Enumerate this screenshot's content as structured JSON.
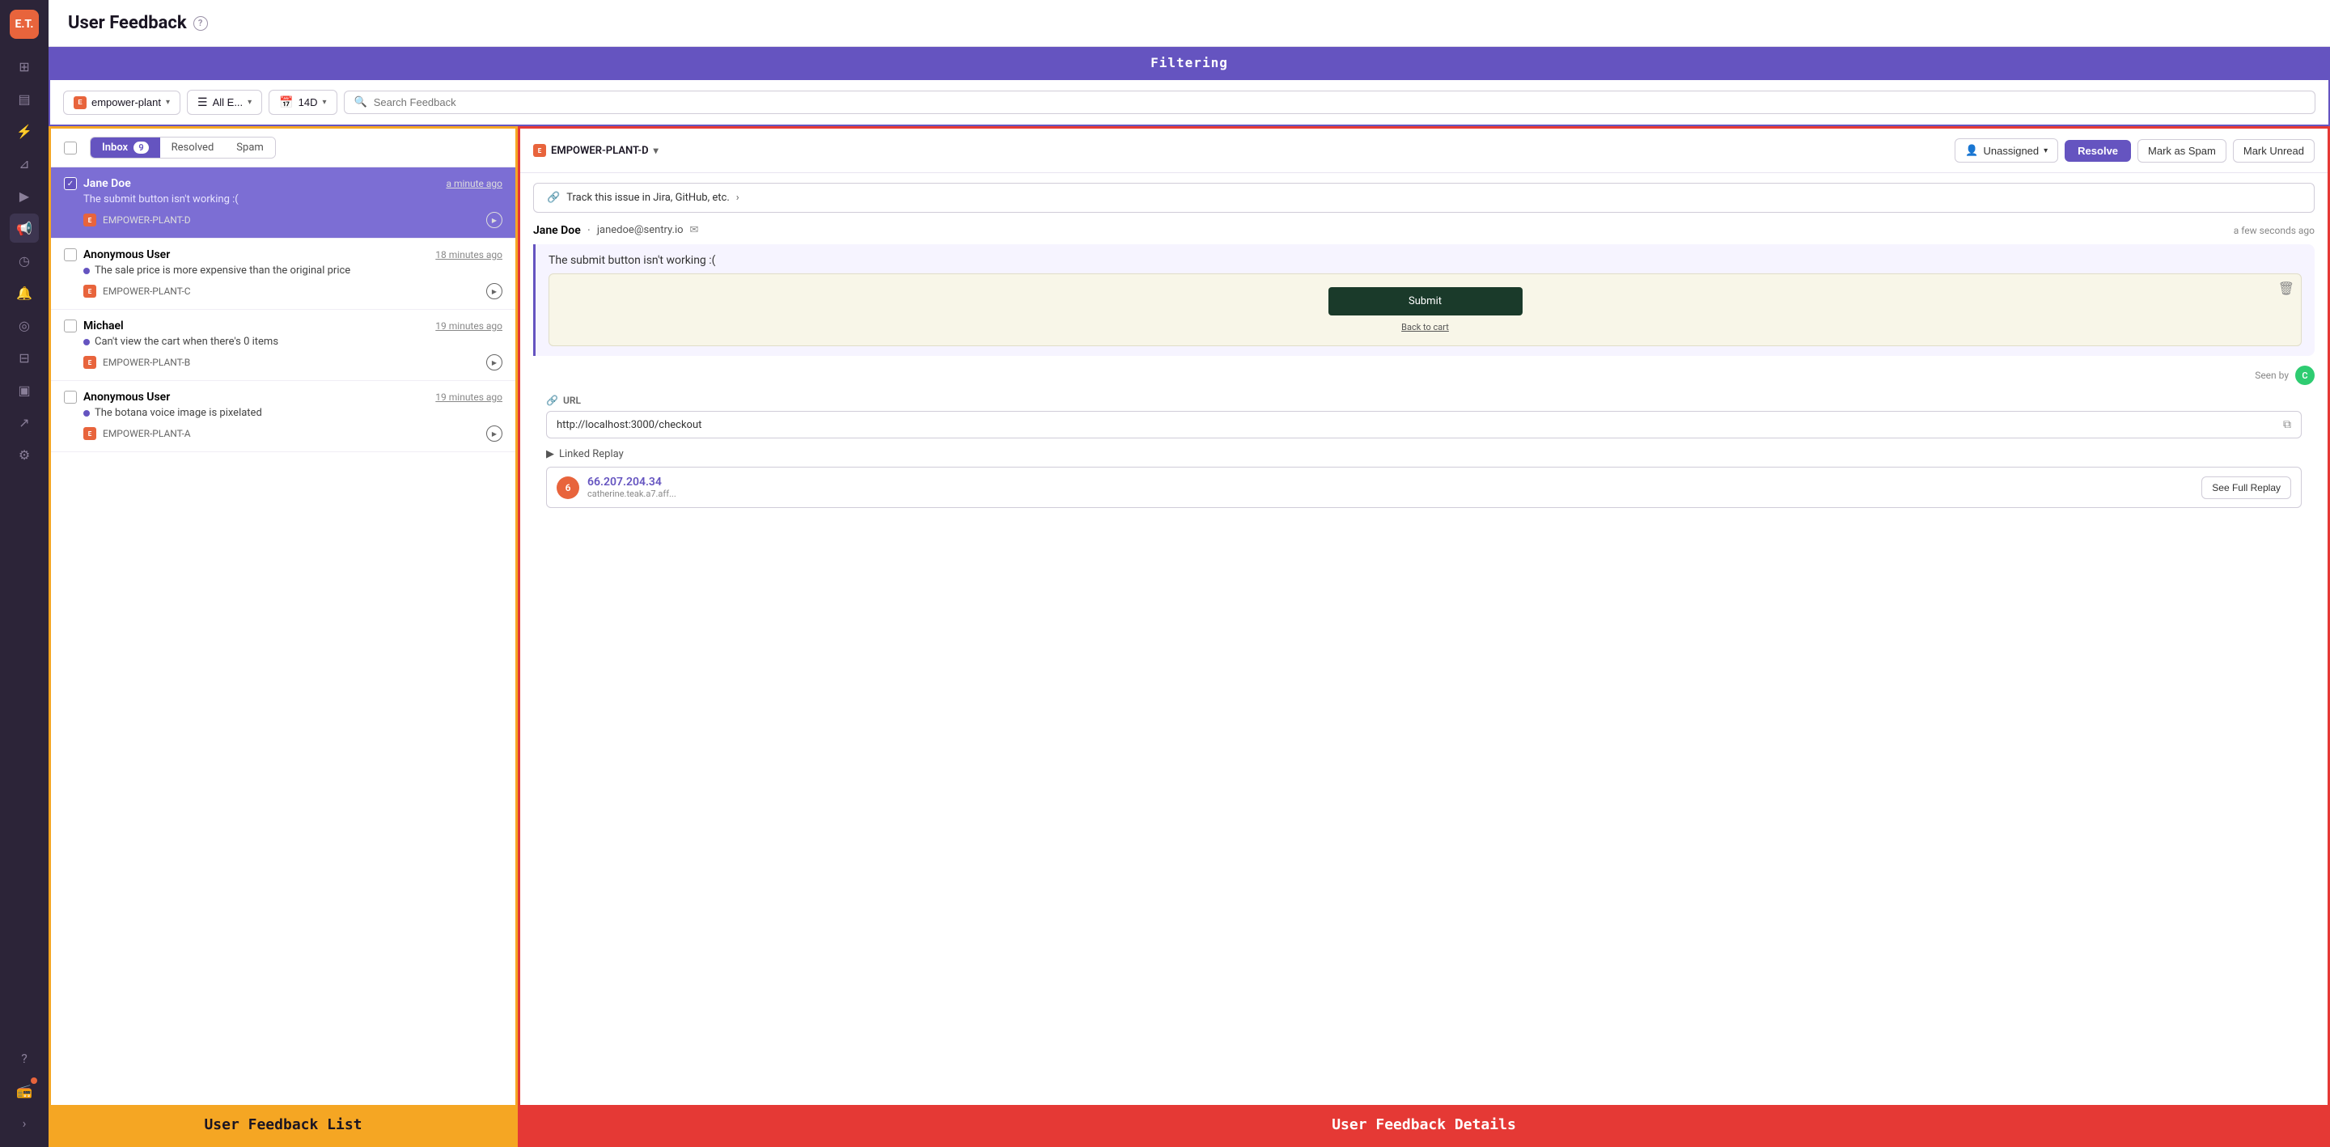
{
  "app": {
    "logo": "E.T.",
    "title": "User Feedback",
    "filtering_label": "Filtering"
  },
  "sidebar": {
    "icons": [
      {
        "name": "grid-icon",
        "symbol": "⊞",
        "active": false
      },
      {
        "name": "chart-icon",
        "symbol": "📊",
        "active": false
      },
      {
        "name": "lightning-icon",
        "symbol": "⚡",
        "active": false
      },
      {
        "name": "filter-icon",
        "symbol": "▼",
        "active": false
      },
      {
        "name": "play-icon",
        "symbol": "▶",
        "active": false
      },
      {
        "name": "megaphone-icon",
        "symbol": "📢",
        "active": true
      },
      {
        "name": "clock-icon",
        "symbol": "🕐",
        "active": false
      },
      {
        "name": "alert-icon",
        "symbol": "🔔",
        "active": false
      },
      {
        "name": "search-icon",
        "symbol": "🔍",
        "active": false
      },
      {
        "name": "blocks-icon",
        "symbol": "⬜",
        "active": false
      },
      {
        "name": "archive-icon",
        "symbol": "🗄",
        "active": false
      },
      {
        "name": "graph-icon",
        "symbol": "📈",
        "active": false
      },
      {
        "name": "settings-icon",
        "symbol": "⚙",
        "active": false
      }
    ],
    "bottom_icons": [
      {
        "name": "help-icon",
        "symbol": "?"
      },
      {
        "name": "radio-icon",
        "symbol": "📻",
        "has_badge": true
      }
    ],
    "expand_icon": ">"
  },
  "filter_bar": {
    "project_label": "empower-plant",
    "env_label": "All E...",
    "time_label": "14D",
    "search_placeholder": "Search Feedback"
  },
  "feedback_list": {
    "panel_label": "User Feedback List",
    "tabs": [
      {
        "label": "Inbox",
        "badge": "9",
        "active": true
      },
      {
        "label": "Resolved",
        "active": false
      },
      {
        "label": "Spam",
        "active": false
      }
    ],
    "items": [
      {
        "id": "item-1",
        "name": "Jane Doe",
        "time": "a minute ago",
        "text": "The submit button isn't working :(",
        "project": "EMPOWER-PLANT-D",
        "selected": true,
        "has_dot": false
      },
      {
        "id": "item-2",
        "name": "Anonymous User",
        "time": "18 minutes ago",
        "text": "The sale price is more expensive than the original price",
        "project": "EMPOWER-PLANT-C",
        "selected": false,
        "has_dot": true
      },
      {
        "id": "item-3",
        "name": "Michael",
        "time": "19 minutes ago",
        "text": "Can't view the cart when there's 0 items",
        "project": "EMPOWER-PLANT-B",
        "selected": false,
        "has_dot": true
      },
      {
        "id": "item-4",
        "name": "Anonymous User",
        "time": "19 minutes ago",
        "text": "The botana voice image is pixelated",
        "project": "EMPOWER-PLANT-A",
        "selected": false,
        "has_dot": true
      }
    ]
  },
  "feedback_details": {
    "panel_label": "User Feedback Details",
    "project": "EMPOWER-PLANT-D",
    "unassigned_label": "Unassigned",
    "resolve_label": "Resolve",
    "mark_spam_label": "Mark as Spam",
    "mark_unread_label": "Mark Unread",
    "track_issue_label": "Track this issue in Jira, GitHub, etc.",
    "sender_name": "Jane Doe",
    "sender_email": "janedoe@sentry.io",
    "message_time": "a few seconds ago",
    "message_text": "The submit button isn't working :(",
    "screenshot": {
      "submit_label": "Submit",
      "back_label": "Back to cart"
    },
    "seen_by_label": "Seen by",
    "seen_by_initial": "C",
    "url_section_title": "URL",
    "url_value": "http://localhost:3000/checkout",
    "linked_replay_title": "Linked Replay",
    "replay_ip": "66.207.204.34",
    "replay_details": "catherine.teak.a7.aff...",
    "replay_badge": "6",
    "see_full_replay_label": "See Full Replay"
  }
}
